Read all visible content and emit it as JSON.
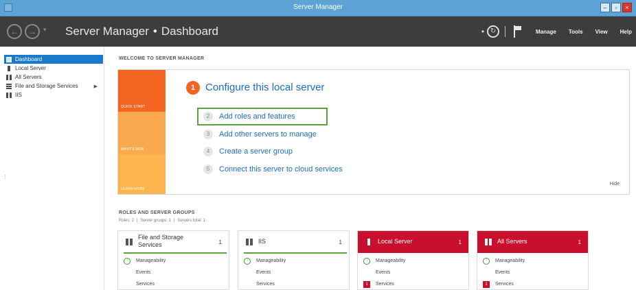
{
  "window": {
    "title": "Server Manager",
    "minimize": "–",
    "maximize": "▫",
    "close": "×"
  },
  "header": {
    "breadcrumb_app": "Server Manager",
    "breadcrumb_sep": "•",
    "breadcrumb_page": "Dashboard",
    "menu": {
      "manage": "Manage",
      "tools": "Tools",
      "view": "View",
      "help": "Help"
    }
  },
  "sidebar": {
    "items": [
      {
        "label": "Dashboard",
        "icon": "dashboard-icon",
        "active": true
      },
      {
        "label": "Local Server",
        "icon": "server-icon"
      },
      {
        "label": "All Servers",
        "icon": "servers-icon"
      },
      {
        "label": "File and Storage Services",
        "icon": "storage-icon",
        "has_children": true
      },
      {
        "label": "IIS",
        "icon": "iis-icon"
      }
    ]
  },
  "welcome": {
    "title": "WELCOME TO SERVER MANAGER",
    "tabs": {
      "quick_start": "QUICK START",
      "whats_new": "WHAT'S NEW",
      "learn_more": "LEARN MORE"
    },
    "step1_number": "1",
    "configure_label": "Configure this local server",
    "steps": [
      {
        "number": "2",
        "label": "Add roles and features"
      },
      {
        "number": "3",
        "label": "Add other servers to manage"
      },
      {
        "number": "4",
        "label": "Create a server group"
      },
      {
        "number": "5",
        "label": "Connect this server to cloud services"
      }
    ],
    "hide_label": "Hide"
  },
  "roles": {
    "title": "ROLES AND SERVER GROUPS",
    "summary": {
      "roles": "Roles: 2",
      "groups": "Server groups: 1",
      "total": "Servers total: 1",
      "sep": "|"
    },
    "cards": [
      {
        "title": "File and Storage Services",
        "count": "1",
        "status": "ok",
        "rows": [
          "Manageability",
          "Events",
          "Services"
        ]
      },
      {
        "title": "IIS",
        "count": "1",
        "status": "ok",
        "rows": [
          "Manageability",
          "Events",
          "Services"
        ]
      },
      {
        "title": "Local Server",
        "count": "1",
        "status": "alert",
        "rows": [
          "Manageability",
          "Events",
          "Services"
        ],
        "services_badge": "1"
      },
      {
        "title": "All Servers",
        "count": "1",
        "status": "alert",
        "rows": [
          "Manageability",
          "Events",
          "Services"
        ],
        "services_badge": "1"
      }
    ]
  },
  "colors": {
    "accent": "#1979ca",
    "quick_start": "#f26522",
    "whats_new": "#f9a94e",
    "alert": "#c8102e",
    "ok": "#3a9b35",
    "highlight": "#5aa43a"
  }
}
